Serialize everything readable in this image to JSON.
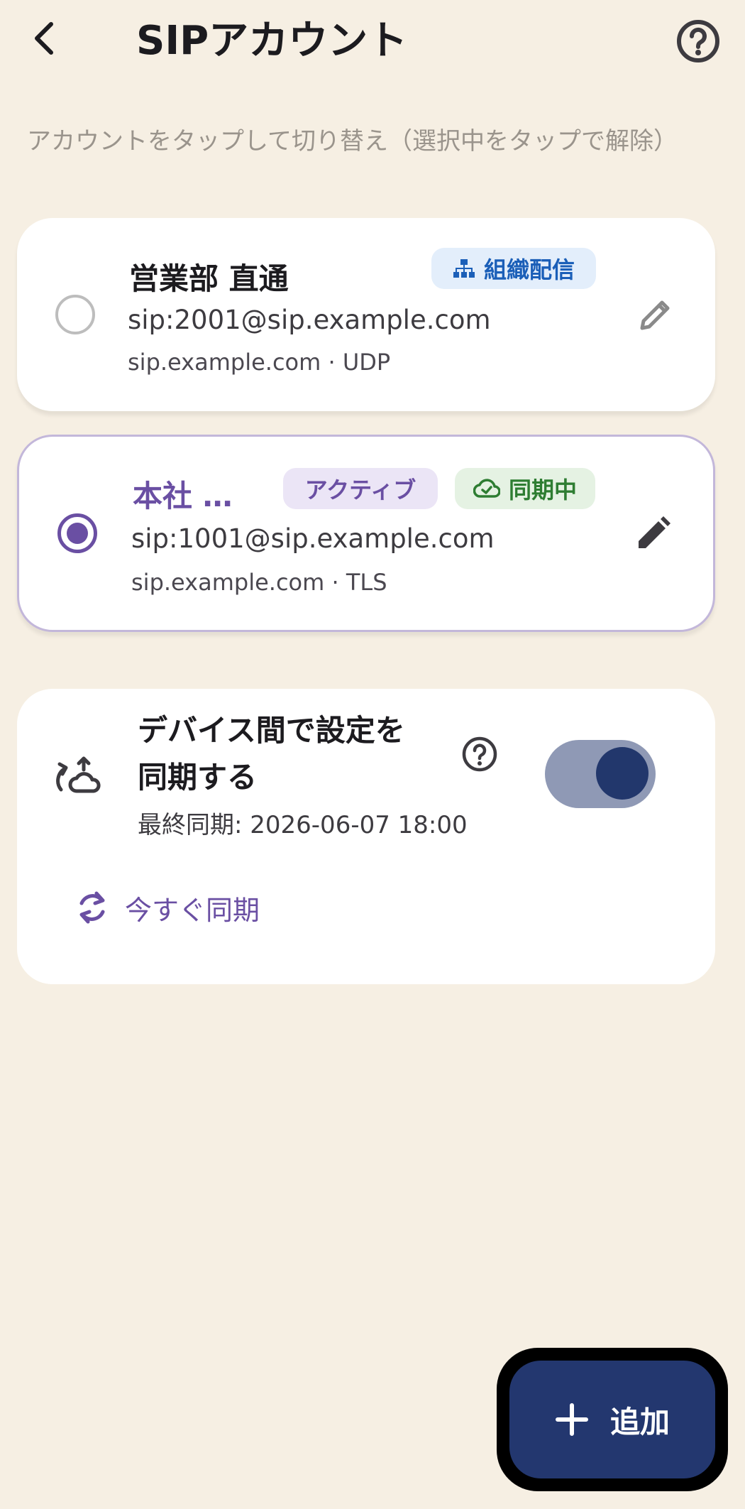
{
  "app_bar": {
    "title": "SIPアカウント",
    "back_icon": "chevron-left-icon",
    "help_icon": "help-circle-icon"
  },
  "hint": "アカウントをタップして切り替え（選択中をタップで解除）",
  "accounts": [
    {
      "name": "営業部 直通",
      "uri": "sip:2001@sip.example.com",
      "meta": "sip.example.com · UDP",
      "selected": false,
      "chips": [
        {
          "label": "組織配信",
          "icon": "org-chart-icon",
          "color": "#1b5fb8"
        }
      ]
    },
    {
      "name": "本社 …",
      "uri": "sip:1001@sip.example.com",
      "meta": "sip.example.com · TLS",
      "selected": true,
      "chips": [
        {
          "label": "アクティブ",
          "color": "#6a4fa3"
        },
        {
          "label": "同期中",
          "icon": "cloud-done-icon",
          "color": "#2e7d32"
        }
      ]
    }
  ],
  "sync": {
    "title": "デバイス間で設定を同期する",
    "title_line1": "デバイス間で設定を",
    "title_line2": "同期する",
    "last_sync": "最終同期: 2026-06-07 18:00",
    "enabled": true,
    "sync_now_label": "今すぐ同期",
    "icon": "cloud-sync-icon"
  },
  "fab": {
    "label": "追加",
    "icon": "plus-icon"
  },
  "colors": {
    "background": "#f6efe3",
    "accent": "#6a4fa3",
    "primary": "#23376f"
  }
}
